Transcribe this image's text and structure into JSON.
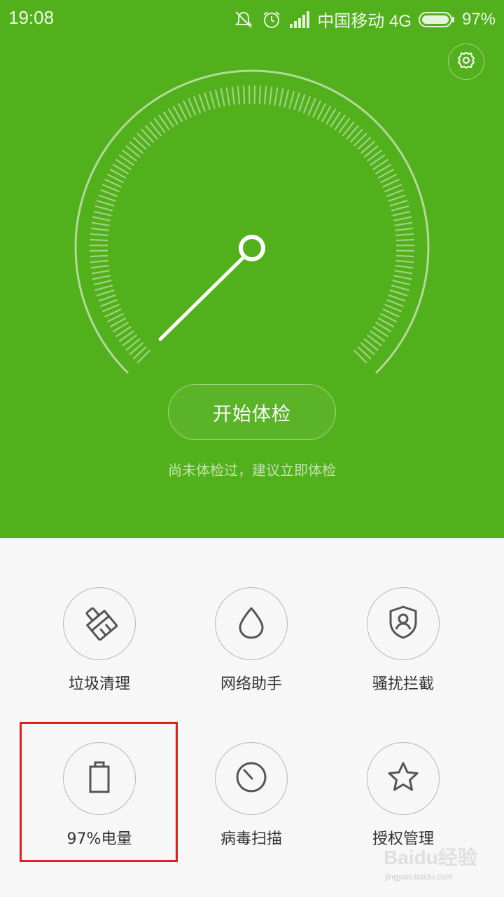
{
  "status_bar": {
    "time": "19:08",
    "carrier": "中国移动 4G",
    "battery": "97%",
    "icons": [
      "notifications-off-icon",
      "alarm-icon",
      "signal-icon",
      "battery-icon"
    ]
  },
  "header": {
    "settings_icon": "gear-icon",
    "start_button": "开始体检",
    "hint": "尚未体检过，建议立即体检"
  },
  "tools": [
    {
      "label": "垃圾清理",
      "icon": "broom-icon"
    },
    {
      "label": "网络助手",
      "icon": "droplet-icon"
    },
    {
      "label": "骚扰拦截",
      "icon": "shield-user-icon"
    },
    {
      "label": "97%电量",
      "icon": "battery-icon"
    },
    {
      "label": "病毒扫描",
      "icon": "scan-icon"
    },
    {
      "label": "授权管理",
      "icon": "star-icon"
    }
  ],
  "colors": {
    "primary": "#51b01b",
    "background": "#f7f7f7",
    "highlight": "#e02020"
  },
  "watermark": {
    "logo": "Baidu经验",
    "url": "jingyan.baidu.com"
  }
}
